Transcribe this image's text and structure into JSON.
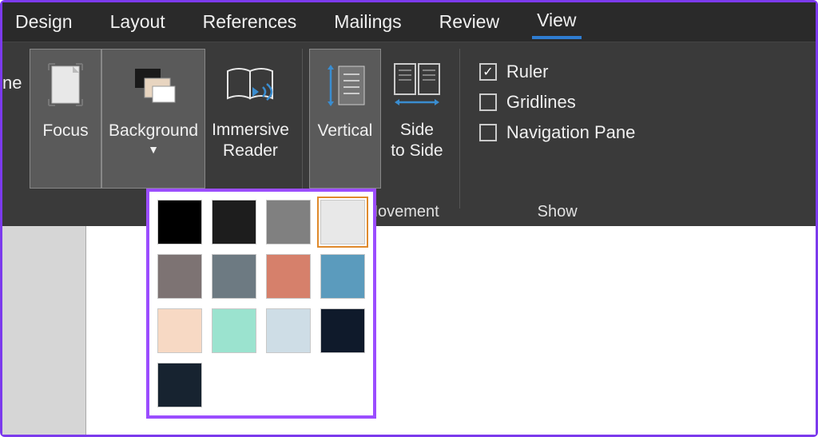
{
  "tabs": {
    "design": "Design",
    "layout": "Layout",
    "references": "References",
    "mailings": "Mailings",
    "review": "Review",
    "view": "View",
    "active": "view"
  },
  "truncated": "ne",
  "buttons": {
    "focus": "Focus",
    "background": "Background",
    "immersive_line1": "Immersive",
    "immersive_line2": "Reader",
    "vertical": "Vertical",
    "side_line1": "Side",
    "side_line2": "to Side"
  },
  "groups": {
    "page_movement": "Page Movement",
    "show": "Show"
  },
  "checkboxes": {
    "ruler": {
      "label": "Ruler",
      "checked": true
    },
    "gridlines": {
      "label": "Gridlines",
      "checked": false
    },
    "navigation": {
      "label": "Navigation Pane",
      "checked": false
    }
  },
  "palette": {
    "selected_index": 3,
    "colors": [
      "#000000",
      "#1d1d1d",
      "#808080",
      "#e8e8e8",
      "#7d7373",
      "#6d7a82",
      "#d6806b",
      "#5b9bbd",
      "#f7d9c4",
      "#9be3cf",
      "#cedde6",
      "#0f1a2b",
      "#172330"
    ]
  }
}
